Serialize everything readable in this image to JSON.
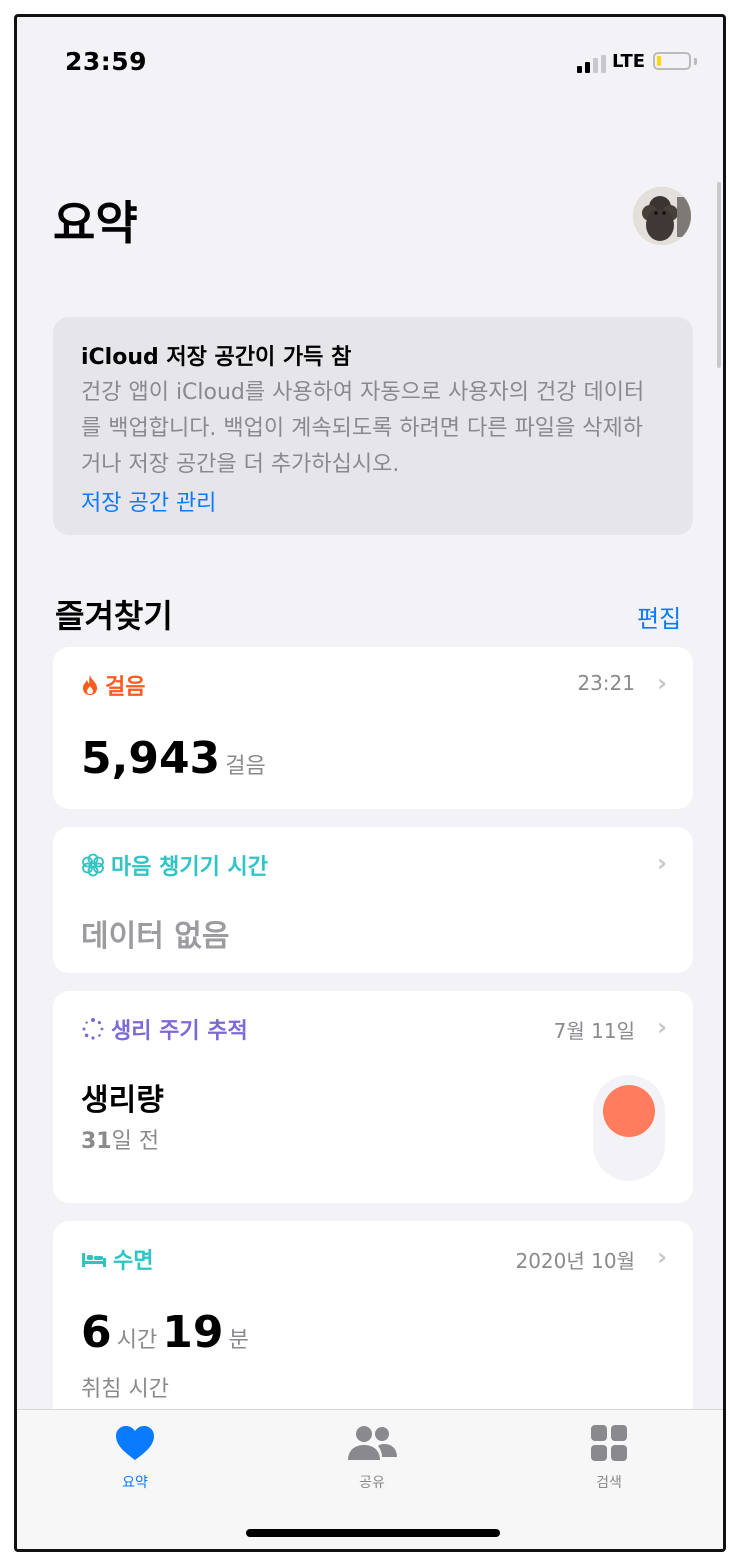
{
  "status_bar": {
    "time": "23:59",
    "network": "LTE"
  },
  "header": {
    "title": "요약"
  },
  "notice": {
    "title": "iCloud 저장 공간이 가득 참",
    "body": "건강 앱이 iCloud를 사용하여 자동으로 사용자의 건강 데이터를 백업합니다. 백업이 계속되도록 하려면 다른 파일을 삭제하거나 저장 공간을 더 추가하십시오.",
    "link": "저장 공간 관리"
  },
  "favorites": {
    "title": "즐겨찾기",
    "edit": "편집",
    "cards": {
      "steps": {
        "title": "걸음",
        "time": "23:21",
        "value": "5,943",
        "unit": "걸음",
        "color": "#ff5a1f"
      },
      "mindful": {
        "title": "마음 챙기기 시간",
        "value": "데이터 없음",
        "color": "#30c4c4"
      },
      "cycle": {
        "title": "생리 주기 추적",
        "date": "7월 11일",
        "label": "생리량",
        "days_num": "31",
        "days_suffix": "일 전",
        "color": "#7d6ad6",
        "dot_color": "#ff7c5c"
      },
      "sleep": {
        "title": "수면",
        "date": "2020년 10월",
        "hours": "6",
        "hours_unit": "시간",
        "minutes": "19",
        "minutes_unit": "분",
        "label": "취침 시간",
        "color": "#2bc6c4"
      }
    }
  },
  "tabbar": {
    "items": [
      {
        "label": "요약",
        "icon": "heart-icon",
        "active": true
      },
      {
        "label": "공유",
        "icon": "people-icon",
        "active": false
      },
      {
        "label": "검색",
        "icon": "grid-icon",
        "active": false
      }
    ],
    "active_color": "#0a7aff",
    "inactive_color": "#8a8a8e"
  }
}
